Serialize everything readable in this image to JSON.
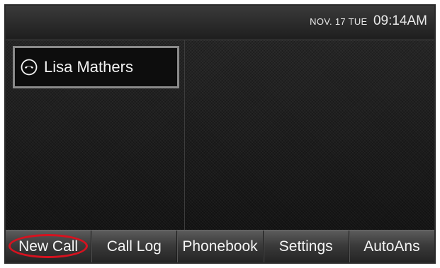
{
  "statusbar": {
    "date": "NOV. 17 TUE",
    "time": "09:14AM"
  },
  "line_key": {
    "label": "Lisa Mathers",
    "icon": "handset-icon"
  },
  "softkeys": [
    {
      "label": "New Call",
      "highlighted": true
    },
    {
      "label": "Call Log"
    },
    {
      "label": "Phonebook"
    },
    {
      "label": "Settings"
    },
    {
      "label": "AutoAns"
    }
  ],
  "colors": {
    "highlight_ring": "#d6121f",
    "line_key_border": "#8a8a8a"
  }
}
